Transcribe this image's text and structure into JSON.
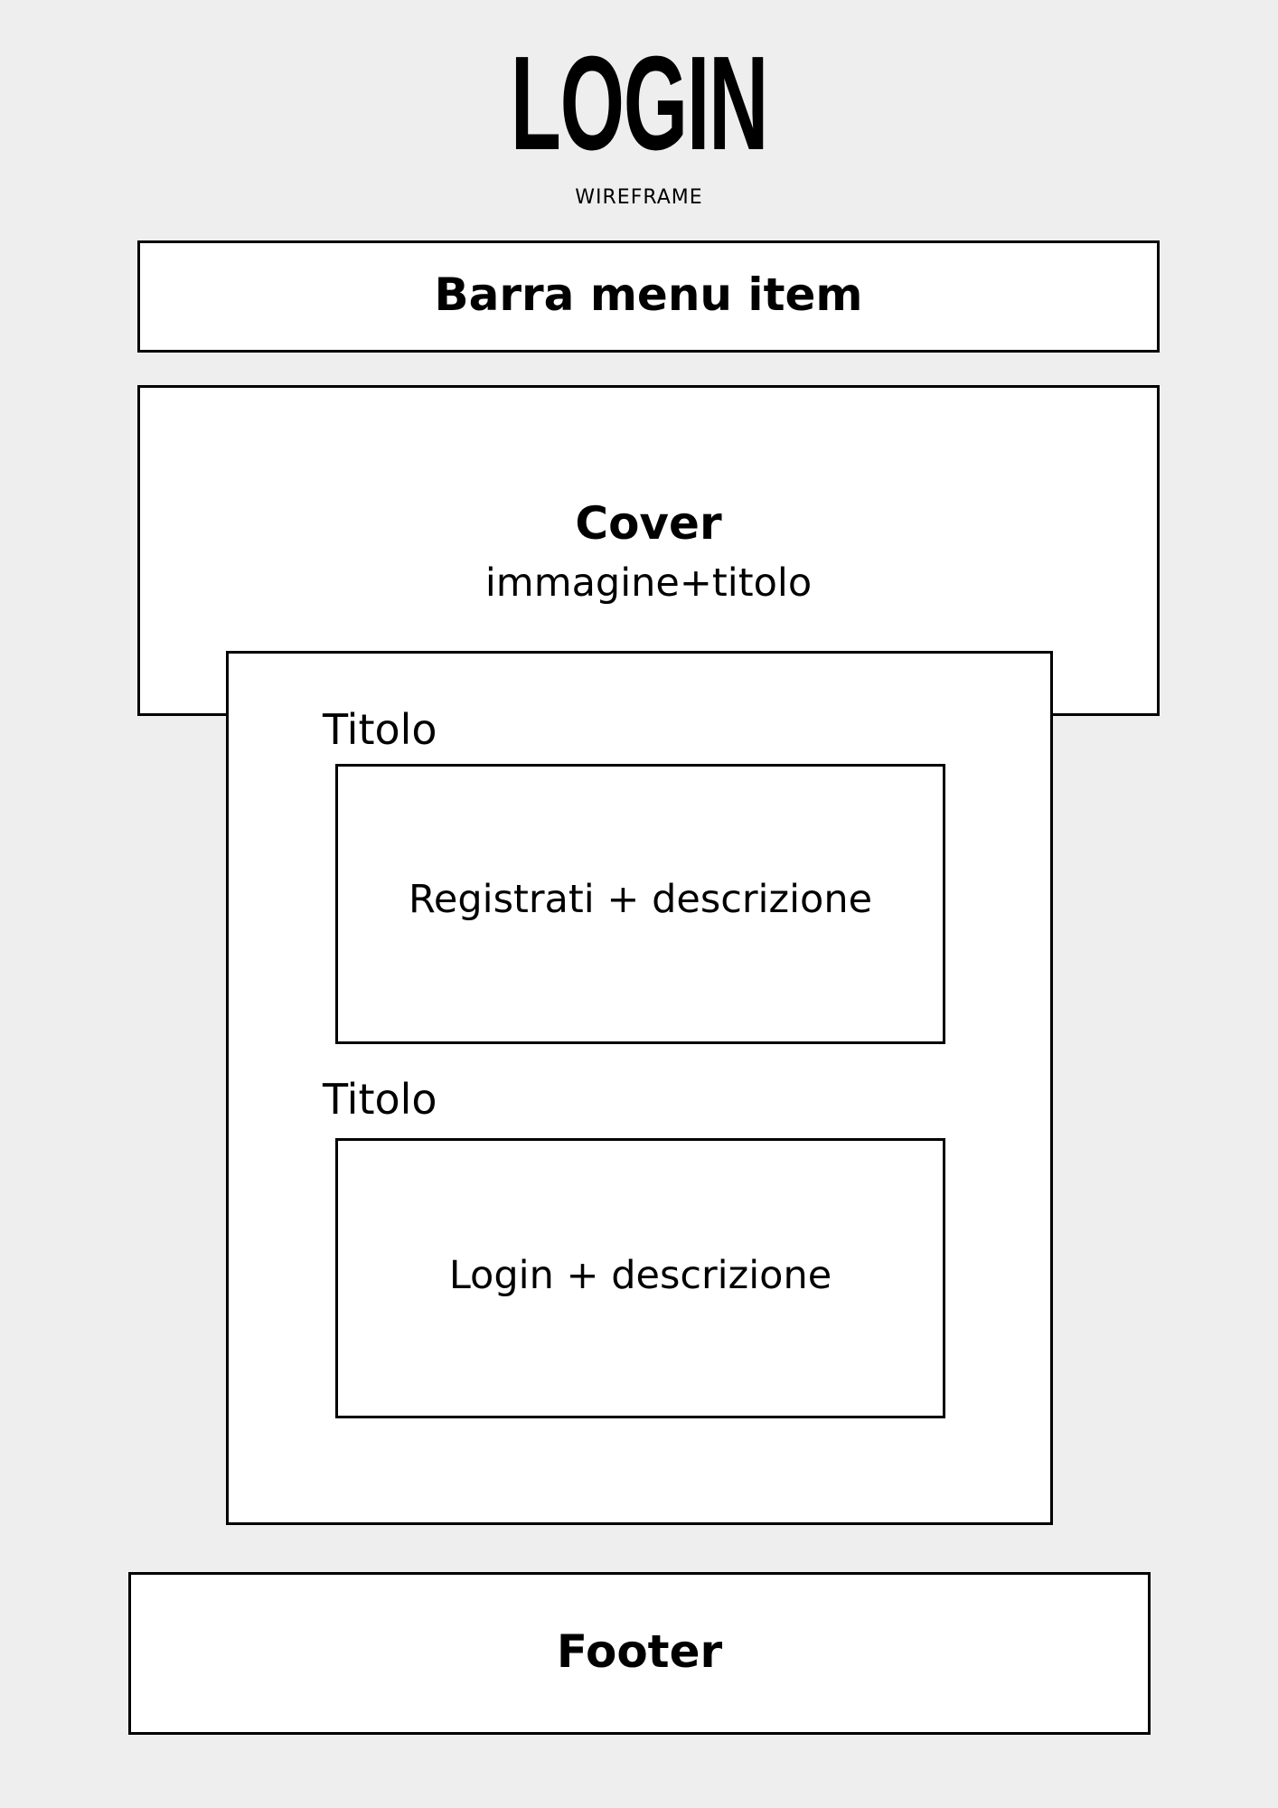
{
  "header": {
    "title": "LOGIN",
    "subtitle": "WIREFRAME"
  },
  "menu_bar": {
    "label": "Barra menu item"
  },
  "cover": {
    "label": "Cover",
    "description": "immagine+titolo"
  },
  "content": {
    "register_section": {
      "title": "Titolo",
      "box_label": "Registrati + descrizione"
    },
    "login_section": {
      "title": "Titolo",
      "box_label": "Login + descrizione"
    }
  },
  "footer": {
    "label": "Footer"
  },
  "colors": {
    "background": "#eeeeee",
    "box_fill": "#ffffff",
    "stroke": "#000000"
  }
}
